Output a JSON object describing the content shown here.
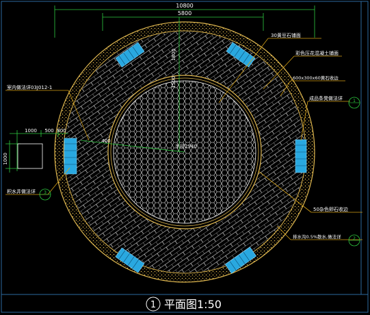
{
  "colors": {
    "background": "#000000",
    "paving_ring": "#e0b850",
    "tile_lines": "#ffffff",
    "dimension": "#2ecc40",
    "leader": "#d4a017",
    "bench": "#29a8e0",
    "frame": "#2d6a9f",
    "text": "#ffffff"
  },
  "dimensions": {
    "overall_width": "10800",
    "inner_width": "5800",
    "left_block": "1000",
    "left_gap": "500",
    "left_gap2": "800",
    "left_height": "1000",
    "radius_label": "400",
    "vertical_a": "1800",
    "vertical_b": "1500",
    "center_label": "半径2940"
  },
  "annotations": [
    {
      "key": "granite_edge",
      "text": "30黄豆石铺面"
    },
    {
      "key": "colored_concrete",
      "text": "彩色压花混凝土铺面"
    },
    {
      "key": "stone_edge",
      "text": "600x300x60黄石收边"
    },
    {
      "key": "bench_detail",
      "text": "成品条凳做法详"
    },
    {
      "key": "bench_sign",
      "text": "1"
    },
    {
      "key": "slope",
      "text": "室内做法详03J012-1"
    },
    {
      "key": "pipe",
      "text": "积水井做法详"
    },
    {
      "key": "pipe_sign",
      "text": "3"
    },
    {
      "key": "border_stone",
      "text": "50杂色卵石收边"
    },
    {
      "key": "drain",
      "text": "排水沟0.5%散水,做法详"
    },
    {
      "key": "drain_sign",
      "text": "2"
    }
  ],
  "title": {
    "number": "1",
    "text": "平面图1:50"
  },
  "icons": [
    "section-circle-icon",
    "bench-icon",
    "north-indicator-icon"
  ]
}
